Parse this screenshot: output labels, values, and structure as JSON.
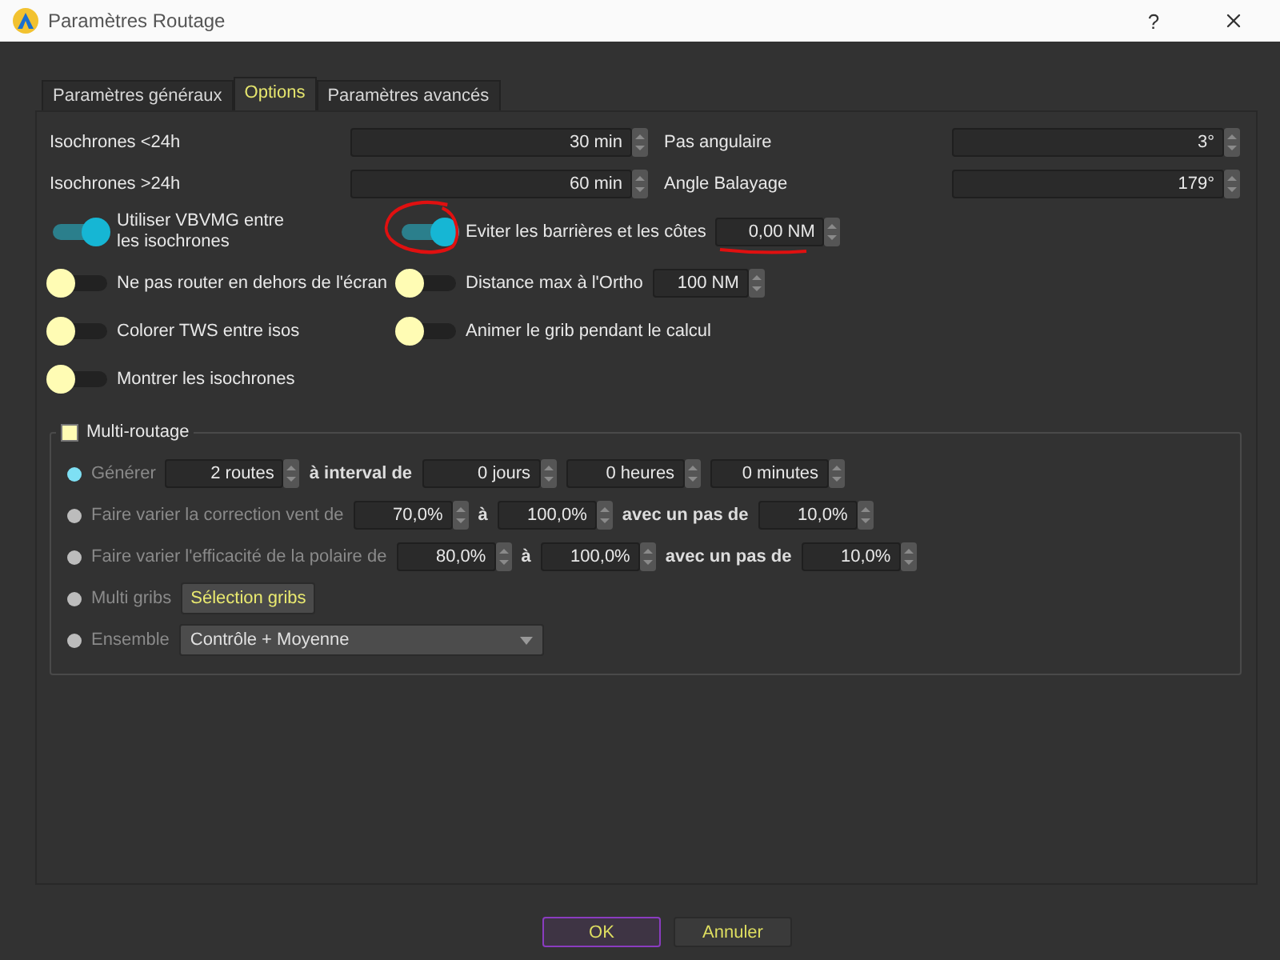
{
  "window": {
    "title": "Paramètres Routage",
    "help": "?"
  },
  "tabs": [
    {
      "label": "Paramètres généraux",
      "selected": false
    },
    {
      "label": "Options",
      "selected": true
    },
    {
      "label": "Paramètres avancés",
      "selected": false
    }
  ],
  "spin_rows": [
    {
      "left": {
        "label": "Isochrones <24h",
        "value": "30 min"
      },
      "right": {
        "label": "Pas angulaire",
        "value": "3°"
      }
    },
    {
      "left": {
        "label": "Isochrones >24h",
        "value": "60 min"
      },
      "right": {
        "label": "Angle Balayage",
        "value": "179°"
      }
    }
  ],
  "toggle_rows": [
    {
      "left": {
        "label": "Utiliser VBVMG entre les isochrones",
        "on": true
      },
      "right": {
        "label": "Eviter les barrières et les côtes",
        "on": true,
        "value": "0,00 NM",
        "annotated": true
      }
    },
    {
      "left": {
        "label": "Ne pas router en dehors de l'écran",
        "on": false
      },
      "right": {
        "label": "Distance max à l'Ortho",
        "on": false,
        "value": "100 NM"
      }
    },
    {
      "left": {
        "label": "Colorer TWS entre isos",
        "on": false
      },
      "right": {
        "label": "Animer le grib pendant le calcul",
        "on": false
      }
    },
    {
      "left": {
        "label": "Montrer les isochrones",
        "on": false
      }
    }
  ],
  "multi": {
    "label": "Multi-routage",
    "checked": false,
    "options": [
      {
        "selected": true,
        "label": "Générer",
        "parts": [
          {
            "kind": "spin",
            "text": "2 routes"
          },
          {
            "kind": "text",
            "text": "à interval de"
          },
          {
            "kind": "spin",
            "text": "0 jours"
          },
          {
            "kind": "spin",
            "text": "0 heures"
          },
          {
            "kind": "spin",
            "text": "0 minutes"
          }
        ]
      },
      {
        "selected": false,
        "label": "Faire varier la correction vent de",
        "parts": [
          {
            "kind": "spin",
            "text": "70,0%"
          },
          {
            "kind": "text",
            "text": "à"
          },
          {
            "kind": "spin",
            "text": "100,0%"
          },
          {
            "kind": "text",
            "text": "avec un pas de"
          },
          {
            "kind": "spin",
            "text": "10,0%"
          }
        ]
      },
      {
        "selected": false,
        "label": "Faire varier l'efficacité de la polaire de",
        "parts": [
          {
            "kind": "spin",
            "text": "80,0%"
          },
          {
            "kind": "text",
            "text": "à"
          },
          {
            "kind": "spin",
            "text": "100,0%"
          },
          {
            "kind": "text",
            "text": "avec un pas de"
          },
          {
            "kind": "spin",
            "text": "10,0%"
          }
        ]
      },
      {
        "selected": false,
        "label": "Multi gribs",
        "parts": [
          {
            "kind": "button",
            "text": "Sélection gribs"
          }
        ]
      },
      {
        "selected": false,
        "label": "Ensemble",
        "parts": [
          {
            "kind": "combo",
            "text": "Contrôle + Moyenne"
          }
        ]
      }
    ]
  },
  "buttons": [
    {
      "label": "OK",
      "focused": true
    },
    {
      "label": "Annuler",
      "focused": false
    }
  ]
}
